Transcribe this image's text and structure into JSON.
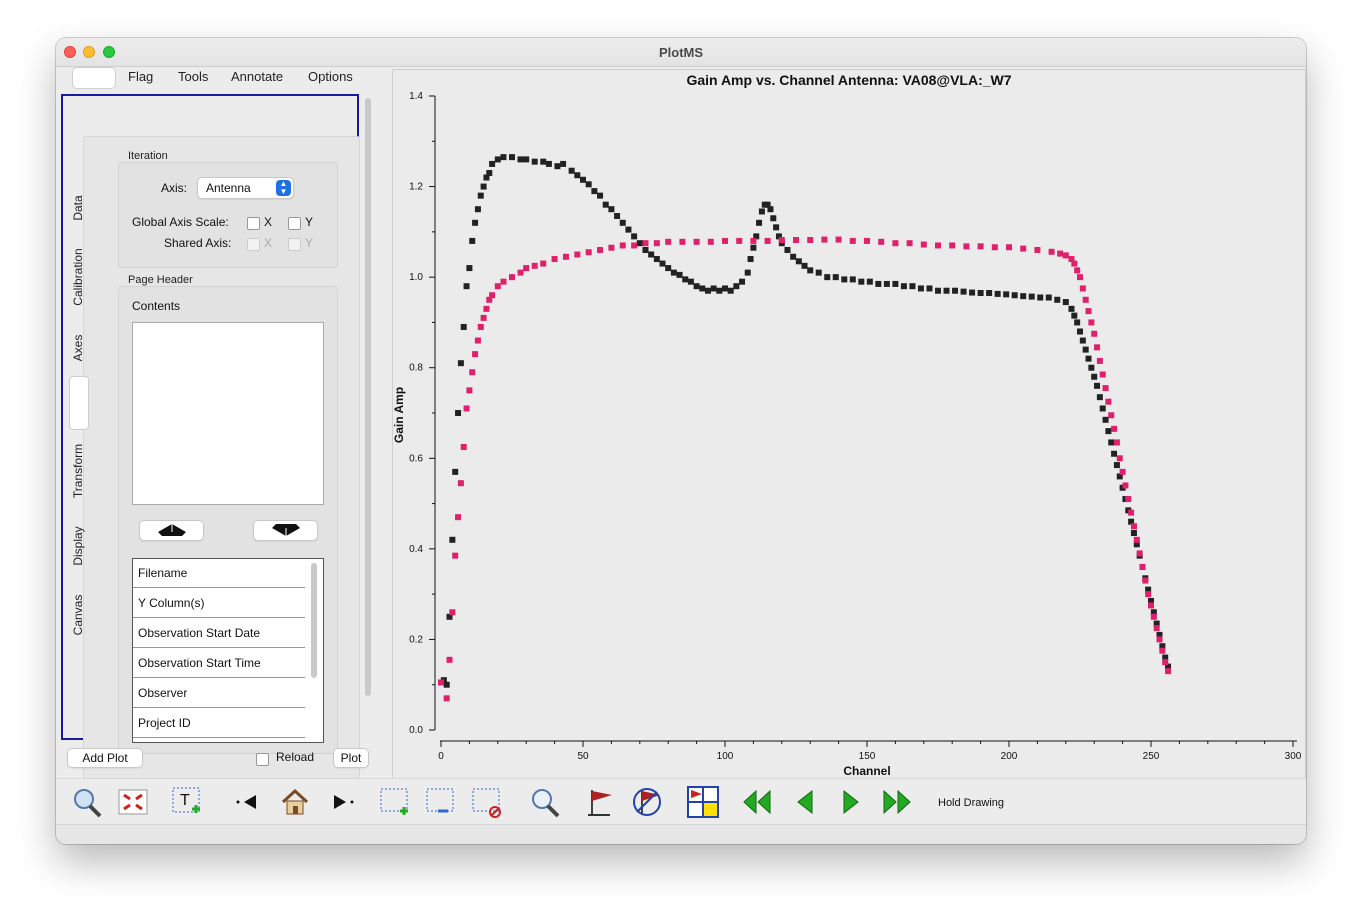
{
  "window": {
    "title": "PlotMS"
  },
  "menu_tabs": [
    "Flag",
    "Tools",
    "Annotate",
    "Options"
  ],
  "side_tabs": [
    "Data",
    "Calibration",
    "Axes",
    "Transform",
    "Display",
    "Canvas"
  ],
  "iteration": {
    "group_label": "Iteration",
    "axis_label": "Axis:",
    "axis_value": "Antenna",
    "global_scale_label": "Global Axis Scale:",
    "shared_axis_label": "Shared Axis:",
    "x": "X",
    "y": "Y"
  },
  "page_header": {
    "group_label": "Page Header",
    "contents_label": "Contents",
    "items": [
      "Filename",
      "Y Column(s)",
      "Observation Start Date",
      "Observation Start Time",
      "Observer",
      "Project ID"
    ]
  },
  "bottom": {
    "add_plot": "Add Plot",
    "reload": "Reload",
    "plot": "Plot"
  },
  "toolbar": {
    "hold_drawing": "Hold Drawing"
  },
  "colors": {
    "series_black": "#222222",
    "series_magenta": "#e0206a",
    "accent": "#1f6fe5",
    "frame": "#1a1aa0"
  },
  "chart_data": {
    "type": "scatter",
    "title": "Gain Amp vs. Channel Antenna: VA08@VLA:_W7",
    "xlabel": "Channel",
    "ylabel": "Gain Amp",
    "xlim": [
      0,
      300
    ],
    "ylim": [
      0,
      1.4
    ],
    "x_ticks": [
      0,
      50,
      100,
      150,
      200,
      250,
      300
    ],
    "y_ticks": [
      0,
      0.2,
      0.4,
      0.6,
      0.8,
      1.0,
      1.2,
      1.4
    ],
    "y_tick_labels": [
      "0.0",
      "0.2",
      "0.4",
      "0.6",
      "0.8",
      "1.0",
      "1.2",
      "1.4"
    ],
    "grid": false,
    "series": [
      {
        "color": "#222222",
        "points": [
          [
            1,
            0.11
          ],
          [
            2,
            0.1
          ],
          [
            3,
            0.25
          ],
          [
            4,
            0.42
          ],
          [
            5,
            0.57
          ],
          [
            6,
            0.7
          ],
          [
            7,
            0.81
          ],
          [
            8,
            0.89
          ],
          [
            9,
            0.98
          ],
          [
            10,
            1.02
          ],
          [
            11,
            1.08
          ],
          [
            12,
            1.12
          ],
          [
            13,
            1.15
          ],
          [
            14,
            1.18
          ],
          [
            15,
            1.2
          ],
          [
            16,
            1.22
          ],
          [
            17,
            1.23
          ],
          [
            18,
            1.25
          ],
          [
            20,
            1.26
          ],
          [
            22,
            1.265
          ],
          [
            25,
            1.265
          ],
          [
            28,
            1.26
          ],
          [
            30,
            1.26
          ],
          [
            33,
            1.255
          ],
          [
            36,
            1.255
          ],
          [
            38,
            1.25
          ],
          [
            41,
            1.245
          ],
          [
            43,
            1.25
          ],
          [
            46,
            1.235
          ],
          [
            48,
            1.225
          ],
          [
            50,
            1.215
          ],
          [
            52,
            1.205
          ],
          [
            54,
            1.19
          ],
          [
            56,
            1.18
          ],
          [
            58,
            1.16
          ],
          [
            60,
            1.15
          ],
          [
            62,
            1.135
          ],
          [
            64,
            1.12
          ],
          [
            66,
            1.105
          ],
          [
            68,
            1.09
          ],
          [
            70,
            1.075
          ],
          [
            72,
            1.06
          ],
          [
            74,
            1.05
          ],
          [
            76,
            1.04
          ],
          [
            78,
            1.03
          ],
          [
            80,
            1.02
          ],
          [
            82,
            1.01
          ],
          [
            84,
            1.005
          ],
          [
            86,
            0.995
          ],
          [
            88,
            0.99
          ],
          [
            90,
            0.98
          ],
          [
            92,
            0.975
          ],
          [
            94,
            0.97
          ],
          [
            96,
            0.975
          ],
          [
            98,
            0.97
          ],
          [
            100,
            0.975
          ],
          [
            102,
            0.97
          ],
          [
            104,
            0.98
          ],
          [
            106,
            0.99
          ],
          [
            108,
            1.01
          ],
          [
            109,
            1.04
          ],
          [
            110,
            1.065
          ],
          [
            111,
            1.09
          ],
          [
            112,
            1.12
          ],
          [
            113,
            1.145
          ],
          [
            114,
            1.16
          ],
          [
            115,
            1.16
          ],
          [
            116,
            1.15
          ],
          [
            117,
            1.13
          ],
          [
            118,
            1.11
          ],
          [
            119,
            1.09
          ],
          [
            120,
            1.075
          ],
          [
            122,
            1.06
          ],
          [
            124,
            1.045
          ],
          [
            126,
            1.035
          ],
          [
            128,
            1.025
          ],
          [
            130,
            1.015
          ],
          [
            133,
            1.01
          ],
          [
            136,
            1.0
          ],
          [
            139,
            1.0
          ],
          [
            142,
            0.995
          ],
          [
            145,
            0.995
          ],
          [
            148,
            0.99
          ],
          [
            151,
            0.99
          ],
          [
            154,
            0.985
          ],
          [
            157,
            0.985
          ],
          [
            160,
            0.985
          ],
          [
            163,
            0.98
          ],
          [
            166,
            0.98
          ],
          [
            169,
            0.975
          ],
          [
            172,
            0.975
          ],
          [
            175,
            0.97
          ],
          [
            178,
            0.97
          ],
          [
            181,
            0.97
          ],
          [
            184,
            0.968
          ],
          [
            187,
            0.966
          ],
          [
            190,
            0.965
          ],
          [
            193,
            0.965
          ],
          [
            196,
            0.963
          ],
          [
            199,
            0.962
          ],
          [
            202,
            0.96
          ],
          [
            205,
            0.958
          ],
          [
            208,
            0.957
          ],
          [
            211,
            0.955
          ],
          [
            214,
            0.955
          ],
          [
            217,
            0.95
          ],
          [
            220,
            0.945
          ],
          [
            222,
            0.93
          ],
          [
            223,
            0.915
          ],
          [
            224,
            0.9
          ],
          [
            225,
            0.88
          ],
          [
            226,
            0.86
          ],
          [
            227,
            0.84
          ],
          [
            228,
            0.82
          ],
          [
            229,
            0.8
          ],
          [
            230,
            0.78
          ],
          [
            231,
            0.76
          ],
          [
            232,
            0.735
          ],
          [
            233,
            0.71
          ],
          [
            234,
            0.685
          ],
          [
            235,
            0.66
          ],
          [
            236,
            0.635
          ],
          [
            237,
            0.61
          ],
          [
            238,
            0.585
          ],
          [
            239,
            0.56
          ],
          [
            240,
            0.535
          ],
          [
            241,
            0.51
          ],
          [
            242,
            0.485
          ],
          [
            243,
            0.46
          ],
          [
            244,
            0.435
          ],
          [
            245,
            0.41
          ],
          [
            246,
            0.385
          ],
          [
            247,
            0.36
          ],
          [
            248,
            0.335
          ],
          [
            249,
            0.31
          ],
          [
            250,
            0.285
          ],
          [
            251,
            0.26
          ],
          [
            252,
            0.235
          ],
          [
            253,
            0.21
          ],
          [
            254,
            0.185
          ],
          [
            255,
            0.16
          ],
          [
            256,
            0.14
          ]
        ]
      },
      {
        "color": "#e0206a",
        "points": [
          [
            0,
            0.105
          ],
          [
            2,
            0.07
          ],
          [
            3,
            0.155
          ],
          [
            4,
            0.26
          ],
          [
            5,
            0.385
          ],
          [
            6,
            0.47
          ],
          [
            7,
            0.545
          ],
          [
            8,
            0.625
          ],
          [
            9,
            0.71
          ],
          [
            10,
            0.75
          ],
          [
            11,
            0.79
          ],
          [
            12,
            0.83
          ],
          [
            13,
            0.86
          ],
          [
            14,
            0.89
          ],
          [
            15,
            0.91
          ],
          [
            16,
            0.93
          ],
          [
            17,
            0.95
          ],
          [
            18,
            0.96
          ],
          [
            20,
            0.98
          ],
          [
            22,
            0.99
          ],
          [
            25,
            1.0
          ],
          [
            28,
            1.01
          ],
          [
            30,
            1.02
          ],
          [
            33,
            1.025
          ],
          [
            36,
            1.03
          ],
          [
            40,
            1.04
          ],
          [
            44,
            1.045
          ],
          [
            48,
            1.05
          ],
          [
            52,
            1.055
          ],
          [
            56,
            1.06
          ],
          [
            60,
            1.065
          ],
          [
            64,
            1.07
          ],
          [
            68,
            1.07
          ],
          [
            72,
            1.075
          ],
          [
            76,
            1.075
          ],
          [
            80,
            1.078
          ],
          [
            85,
            1.078
          ],
          [
            90,
            1.078
          ],
          [
            95,
            1.078
          ],
          [
            100,
            1.08
          ],
          [
            105,
            1.08
          ],
          [
            110,
            1.08
          ],
          [
            115,
            1.08
          ],
          [
            120,
            1.082
          ],
          [
            125,
            1.082
          ],
          [
            130,
            1.082
          ],
          [
            135,
            1.083
          ],
          [
            140,
            1.083
          ],
          [
            145,
            1.08
          ],
          [
            150,
            1.08
          ],
          [
            155,
            1.078
          ],
          [
            160,
            1.075
          ],
          [
            165,
            1.075
          ],
          [
            170,
            1.072
          ],
          [
            175,
            1.07
          ],
          [
            180,
            1.07
          ],
          [
            185,
            1.068
          ],
          [
            190,
            1.068
          ],
          [
            195,
            1.066
          ],
          [
            200,
            1.066
          ],
          [
            205,
            1.063
          ],
          [
            210,
            1.06
          ],
          [
            215,
            1.056
          ],
          [
            218,
            1.052
          ],
          [
            220,
            1.048
          ],
          [
            222,
            1.04
          ],
          [
            223,
            1.03
          ],
          [
            224,
            1.015
          ],
          [
            225,
            1.0
          ],
          [
            226,
            0.975
          ],
          [
            227,
            0.95
          ],
          [
            228,
            0.925
          ],
          [
            229,
            0.9
          ],
          [
            230,
            0.875
          ],
          [
            231,
            0.845
          ],
          [
            232,
            0.815
          ],
          [
            233,
            0.785
          ],
          [
            234,
            0.755
          ],
          [
            235,
            0.725
          ],
          [
            236,
            0.695
          ],
          [
            237,
            0.665
          ],
          [
            238,
            0.635
          ],
          [
            239,
            0.6
          ],
          [
            240,
            0.57
          ],
          [
            241,
            0.54
          ],
          [
            242,
            0.51
          ],
          [
            243,
            0.48
          ],
          [
            244,
            0.45
          ],
          [
            245,
            0.42
          ],
          [
            246,
            0.39
          ],
          [
            247,
            0.36
          ],
          [
            248,
            0.33
          ],
          [
            249,
            0.3
          ],
          [
            250,
            0.275
          ],
          [
            251,
            0.25
          ],
          [
            252,
            0.225
          ],
          [
            253,
            0.2
          ],
          [
            254,
            0.175
          ],
          [
            255,
            0.15
          ],
          [
            256,
            0.13
          ]
        ]
      }
    ]
  }
}
